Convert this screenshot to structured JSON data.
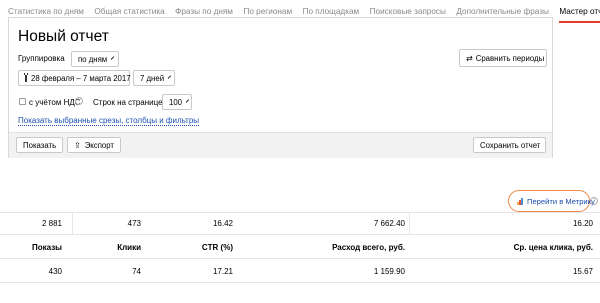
{
  "tabs": [
    {
      "label": "Статистика по дням"
    },
    {
      "label": "Общая статистика"
    },
    {
      "label": "Фразы по дням"
    },
    {
      "label": "По регионам"
    },
    {
      "label": "По площадкам"
    },
    {
      "label": "Поисковые запросы"
    },
    {
      "label": "Дополнительные фразы"
    },
    {
      "label": "Мастер отчётов"
    }
  ],
  "active_tab": "Мастер отчётов",
  "report": {
    "title": "Новый отчет",
    "grouping_label": "Группировка",
    "grouping_value": "по дням",
    "compare_button": "Сравнить периоды",
    "date_range": "28 февраля – 7 марта 2017",
    "period_value": "7 дней",
    "vat_label": "с учётом НДС",
    "vat_help": "?",
    "rows_label": "Строк на странице",
    "rows_value": "100",
    "show_filters_link": "Показать выбранные срезы, столбцы и фильтры",
    "show_button": "Показать",
    "export_button": "Экспорт",
    "save_button": "Сохранить отчет"
  },
  "metrika": {
    "label": "Перейти в Метрику",
    "help": "?",
    "colors": [
      "#f2a83b",
      "#e8573d",
      "#4a90d9"
    ]
  },
  "totals": {
    "shows": "2 881",
    "clicks": "473",
    "ctr": "16.42",
    "spend": "7 662.40",
    "avg_cpc": "16.20"
  },
  "columns": {
    "shows": "Показы",
    "clicks": "Клики",
    "ctr": "CTR (%)",
    "spend": "Расход всего, руб.",
    "avg_cpc": "Ср. цена клика, руб."
  },
  "rows": [
    {
      "shows": "430",
      "clicks": "74",
      "ctr": "17.21",
      "spend": "1 159.90",
      "avg_cpc": "15.67"
    }
  ],
  "colors": {
    "accent": "#e83a2f",
    "link": "#1a4fb0",
    "metrika_border": "#f08a4b"
  }
}
